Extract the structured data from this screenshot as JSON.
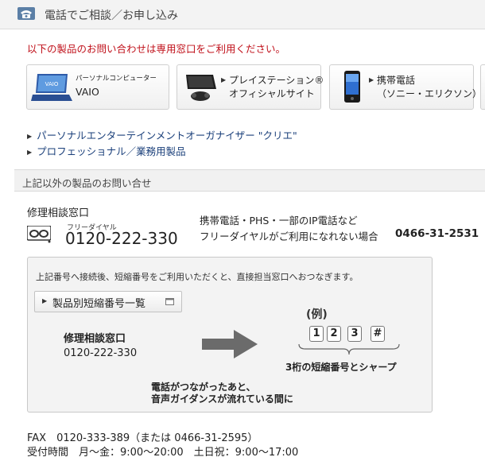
{
  "header": {
    "title": "電話でご相談／お申し込み"
  },
  "notice": "以下の製品のお問い合わせは専用窓口をご利用ください。",
  "products": [
    {
      "small": "パーソナルコンピューター",
      "name": "VAIO",
      "logo": "VAIO"
    },
    {
      "name_line1": "プレイステーション®",
      "name_line2": "オフィシャルサイト"
    },
    {
      "name_line1": "携帯電話",
      "name_line2": "（ソニー・エリクソン）"
    }
  ],
  "links": [
    "パーソナルエンターテインメントオーガナイザー \"クリエ\"",
    "プロフェッショナル／業務用製品"
  ],
  "section_title": "上記以外の製品のお問い合せ",
  "repair": {
    "label": "修理相談窓口",
    "free_dial_label": "フリーダイヤル",
    "phone": "0120-222-330",
    "alt_line1": "携帯電話・PHS・一部のIP電話など",
    "alt_line2": "フリーダイヤルがご利用になれない場合",
    "alt_phone": "0466-31-2531"
  },
  "info_box": {
    "description": "上記番号へ接続後、短縮番号をご利用いただくと、直接担当窓口へおつなぎます。",
    "short_button": "製品別短縮番号一覧",
    "example_label": "(例)",
    "center_label": "修理相談窓口",
    "center_phone": "0120-222-330",
    "keys": [
      "1",
      "2",
      "3",
      "#"
    ],
    "keys_caption": "3桁の短縮番号とシャープ",
    "guide_line1": "電話がつながったあと、",
    "guide_line2": "音声ガイダンスが流れている間に"
  },
  "fax": "FAX　0120-333-389（または 0466-31-2595）",
  "hours": "受付時間　月～金：9:00～20:00　土日祝：9:00～17:00"
}
